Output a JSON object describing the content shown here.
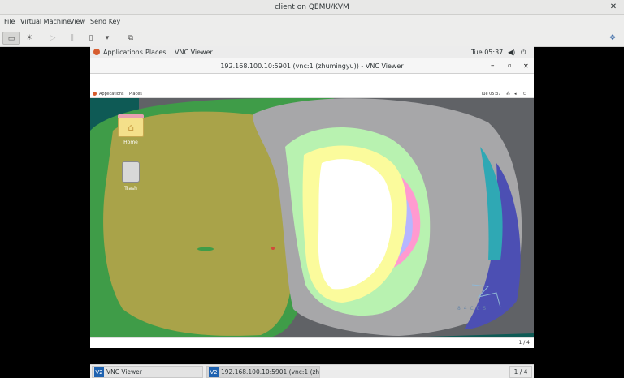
{
  "host": {
    "title": "client on QEMU/KVM",
    "menu": [
      "File",
      "Virtual Machine",
      "View",
      "Send Key"
    ],
    "toolbar_icons": [
      "monitor-icon",
      "lightbulb-icon",
      "play-icon",
      "pause-icon",
      "power-icon",
      "dropdown-icon",
      "snapshot-icon",
      "resize-icon"
    ]
  },
  "guest": {
    "topbar": {
      "applications": "Applications",
      "places": "Places",
      "app_name": "VNC Viewer",
      "clock": "Tue 05:37"
    },
    "vnc_title": "192.168.100.10:5901 (vnc:1 (zhumingyu)) - VNC Viewer",
    "remote": {
      "topbar": {
        "applications": "Applications",
        "places": "Places",
        "clock": "Tue 05:37"
      },
      "desktop_icons": [
        {
          "label": "Home"
        },
        {
          "label": "Trash"
        }
      ],
      "watermark": "8 4 C 0 S"
    },
    "footer_page": "1 / 4"
  },
  "taskbar": {
    "items": [
      {
        "icon": "V2",
        "label": "VNC Viewer"
      },
      {
        "icon": "V2",
        "label": "192.168.100.10:5901 (vnc:1 (zhum..."
      }
    ],
    "page": "1 / 4"
  }
}
